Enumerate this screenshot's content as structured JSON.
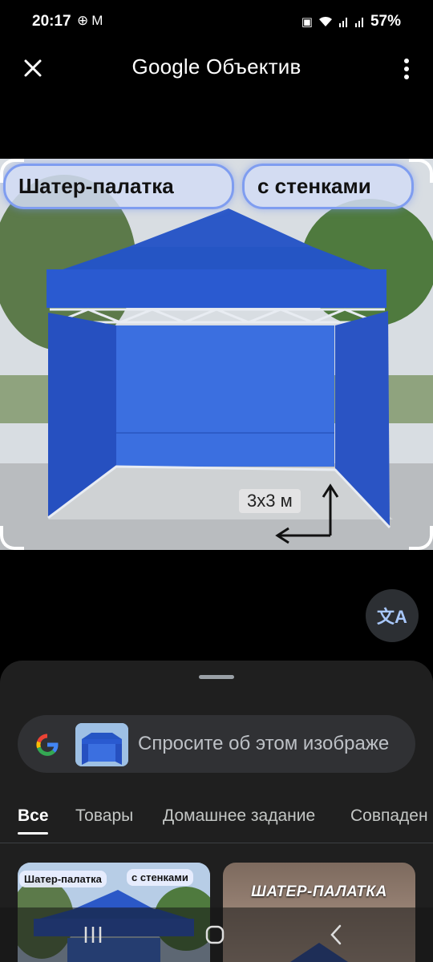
{
  "status_bar": {
    "time": "20:17",
    "left_icons": [
      "circle-plus-icon",
      "gmail-icon"
    ],
    "right_icons": [
      "battery-saver-icon",
      "wifi-icon",
      "signal-icon",
      "signal-icon"
    ],
    "battery": "57%"
  },
  "header": {
    "title": "Google Объектив",
    "close_icon": "close-icon",
    "menu_icon": "more-vert-icon"
  },
  "image": {
    "caption_left": "Шатер-палатка",
    "caption_right": "с стенками",
    "size_label": "3x3 м"
  },
  "translate_button": {
    "icon": "translate-icon",
    "glyph": "文A"
  },
  "sheet": {
    "search": {
      "placeholder": "Спросите об этом изображе"
    },
    "tabs": [
      {
        "label": "Все",
        "active": true
      },
      {
        "label": "Товары",
        "active": false
      },
      {
        "label": "Домашнее задание",
        "active": false
      },
      {
        "label": "Совпаден",
        "active": false
      }
    ],
    "results": [
      {
        "caption_left": "Шатер-палатка",
        "caption_right": "с стенками"
      },
      {
        "title": "ШАТЕР-ПАЛАТКА"
      }
    ]
  },
  "nav_bar": {
    "buttons": [
      "recents-icon",
      "home-icon",
      "back-icon"
    ]
  },
  "colors": {
    "background": "#000000",
    "sheet": "#1f1f1f",
    "pill": "#303134",
    "tent_blue": "#1f4fc0",
    "accent": "#a8c7fa"
  }
}
